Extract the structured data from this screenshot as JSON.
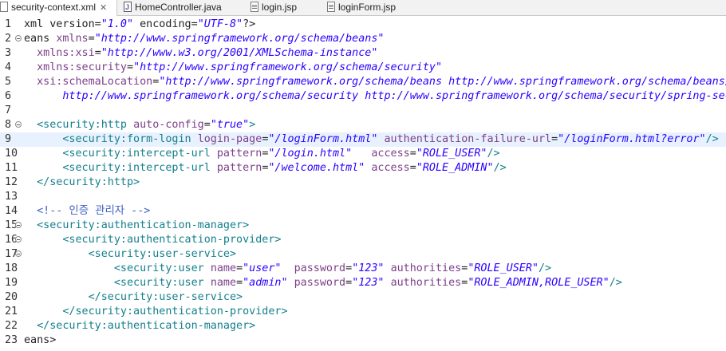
{
  "tabs": [
    {
      "label": "security-context.xml",
      "icon": "xml-file-icon",
      "active": true,
      "closable": true
    },
    {
      "label": "HomeController.java",
      "icon": "java-file-icon",
      "active": false
    },
    {
      "label": "login.jsp",
      "icon": "jsp-file-icon",
      "active": false
    },
    {
      "label": "loginForm.jsp",
      "icon": "jsp-file-icon",
      "active": false
    }
  ],
  "editor": {
    "current_line": 9,
    "lines": [
      {
        "n": "1",
        "fold": false,
        "tokens": [
          [
            "txt",
            "xml version="
          ],
          [
            "val",
            "\"1.0\""
          ],
          [
            "txt",
            " encoding="
          ],
          [
            "val",
            "\"UTF-8\""
          ],
          [
            "txt",
            "?>"
          ]
        ]
      },
      {
        "n": "2",
        "fold": true,
        "tokens": [
          [
            "txt",
            "eans "
          ],
          [
            "attr",
            "xmlns"
          ],
          [
            "txt",
            "="
          ],
          [
            "val",
            "\"http://www.springframework.org/schema/beans\""
          ]
        ]
      },
      {
        "n": "3",
        "fold": false,
        "tokens": [
          [
            "txt",
            "  "
          ],
          [
            "attr",
            "xmlns:xsi"
          ],
          [
            "txt",
            "="
          ],
          [
            "val",
            "\"http://www.w3.org/2001/XMLSchema-instance\""
          ]
        ]
      },
      {
        "n": "4",
        "fold": false,
        "tokens": [
          [
            "txt",
            "  "
          ],
          [
            "attr",
            "xmlns:security"
          ],
          [
            "txt",
            "="
          ],
          [
            "val",
            "\"http://www.springframework.org/schema/security\""
          ]
        ]
      },
      {
        "n": "5",
        "fold": false,
        "tokens": [
          [
            "txt",
            "  "
          ],
          [
            "attr",
            "xsi:schemaLocation"
          ],
          [
            "txt",
            "="
          ],
          [
            "val",
            "\"http://www.springframework.org/schema/beans http://www.springframework.org/schema/beans/"
          ]
        ]
      },
      {
        "n": "6",
        "fold": false,
        "tokens": [
          [
            "val",
            "      http://www.springframework.org/schema/security http://www.springframework.org/schema/security/spring-sec"
          ]
        ]
      },
      {
        "n": "7",
        "fold": false,
        "tokens": []
      },
      {
        "n": "8",
        "fold": true,
        "tokens": [
          [
            "txt",
            "  "
          ],
          [
            "tag",
            "<security:http"
          ],
          [
            "txt",
            " "
          ],
          [
            "attr",
            "auto-config"
          ],
          [
            "txt",
            "="
          ],
          [
            "val",
            "\"true\""
          ],
          [
            "tag",
            ">"
          ]
        ]
      },
      {
        "n": "9",
        "fold": false,
        "tokens": [
          [
            "txt",
            "      "
          ],
          [
            "tag",
            "<security:form-login"
          ],
          [
            "txt",
            " "
          ],
          [
            "attr",
            "login-page"
          ],
          [
            "txt",
            "="
          ],
          [
            "val",
            "\"/loginForm.html\""
          ],
          [
            "txt",
            " "
          ],
          [
            "attr",
            "authentication-failure-url"
          ],
          [
            "txt",
            "="
          ],
          [
            "val",
            "\"/loginForm.html?error\""
          ],
          [
            "tag",
            "/>"
          ]
        ]
      },
      {
        "n": "10",
        "fold": false,
        "tokens": [
          [
            "txt",
            "      "
          ],
          [
            "tag",
            "<security:intercept-url"
          ],
          [
            "txt",
            " "
          ],
          [
            "attr",
            "pattern"
          ],
          [
            "txt",
            "="
          ],
          [
            "val",
            "\"/login.html\""
          ],
          [
            "txt",
            "   "
          ],
          [
            "attr",
            "access"
          ],
          [
            "txt",
            "="
          ],
          [
            "val",
            "\"ROLE_USER\""
          ],
          [
            "tag",
            "/>"
          ]
        ]
      },
      {
        "n": "11",
        "fold": false,
        "tokens": [
          [
            "txt",
            "      "
          ],
          [
            "tag",
            "<security:intercept-url"
          ],
          [
            "txt",
            " "
          ],
          [
            "attr",
            "pattern"
          ],
          [
            "txt",
            "="
          ],
          [
            "val",
            "\"/welcome.html\""
          ],
          [
            "txt",
            " "
          ],
          [
            "attr",
            "access"
          ],
          [
            "txt",
            "="
          ],
          [
            "val",
            "\"ROLE_ADMIN\""
          ],
          [
            "tag",
            "/>"
          ]
        ]
      },
      {
        "n": "12",
        "fold": false,
        "tokens": [
          [
            "txt",
            "  "
          ],
          [
            "tag",
            "</security:http>"
          ]
        ]
      },
      {
        "n": "13",
        "fold": false,
        "tokens": []
      },
      {
        "n": "14",
        "fold": false,
        "tokens": [
          [
            "txt",
            "  "
          ],
          [
            "com",
            "<!-- 인증 관리자 -->"
          ]
        ]
      },
      {
        "n": "15",
        "fold": true,
        "tokens": [
          [
            "txt",
            "  "
          ],
          [
            "tag",
            "<security:authentication-manager>"
          ]
        ]
      },
      {
        "n": "16",
        "fold": true,
        "tokens": [
          [
            "txt",
            "      "
          ],
          [
            "tag",
            "<security:authentication-provider>"
          ]
        ]
      },
      {
        "n": "17",
        "fold": true,
        "tokens": [
          [
            "txt",
            "          "
          ],
          [
            "tag",
            "<security:user-service>"
          ]
        ]
      },
      {
        "n": "18",
        "fold": false,
        "tokens": [
          [
            "txt",
            "              "
          ],
          [
            "tag",
            "<security:user"
          ],
          [
            "txt",
            " "
          ],
          [
            "attr",
            "name"
          ],
          [
            "txt",
            "="
          ],
          [
            "val",
            "\"user\""
          ],
          [
            "txt",
            "  "
          ],
          [
            "attr",
            "password"
          ],
          [
            "txt",
            "="
          ],
          [
            "val",
            "\"123\""
          ],
          [
            "txt",
            " "
          ],
          [
            "attr",
            "authorities"
          ],
          [
            "txt",
            "="
          ],
          [
            "val",
            "\"ROLE_USER\""
          ],
          [
            "tag",
            "/>"
          ]
        ]
      },
      {
        "n": "19",
        "fold": false,
        "tokens": [
          [
            "txt",
            "              "
          ],
          [
            "tag",
            "<security:user"
          ],
          [
            "txt",
            " "
          ],
          [
            "attr",
            "name"
          ],
          [
            "txt",
            "="
          ],
          [
            "val",
            "\"admin\""
          ],
          [
            "txt",
            " "
          ],
          [
            "attr",
            "password"
          ],
          [
            "txt",
            "="
          ],
          [
            "val",
            "\"123\""
          ],
          [
            "txt",
            " "
          ],
          [
            "attr",
            "authorities"
          ],
          [
            "txt",
            "="
          ],
          [
            "val",
            "\"ROLE_ADMIN,ROLE_USER\""
          ],
          [
            "tag",
            "/>"
          ]
        ]
      },
      {
        "n": "20",
        "fold": false,
        "tokens": [
          [
            "txt",
            "          "
          ],
          [
            "tag",
            "</security:user-service>"
          ]
        ]
      },
      {
        "n": "21",
        "fold": false,
        "tokens": [
          [
            "txt",
            "      "
          ],
          [
            "tag",
            "</security:authentication-provider>"
          ]
        ]
      },
      {
        "n": "22",
        "fold": false,
        "tokens": [
          [
            "txt",
            "  "
          ],
          [
            "tag",
            "</security:authentication-manager>"
          ]
        ]
      },
      {
        "n": "23",
        "fold": false,
        "tokens": [
          [
            "txt",
            "eans>"
          ]
        ]
      }
    ]
  },
  "colors": {
    "tag": "#137f8c",
    "attr": "#7d3e8a",
    "value": "#2a00ff",
    "comment": "#3f5fbf",
    "current_line": "#e8f2fe"
  }
}
